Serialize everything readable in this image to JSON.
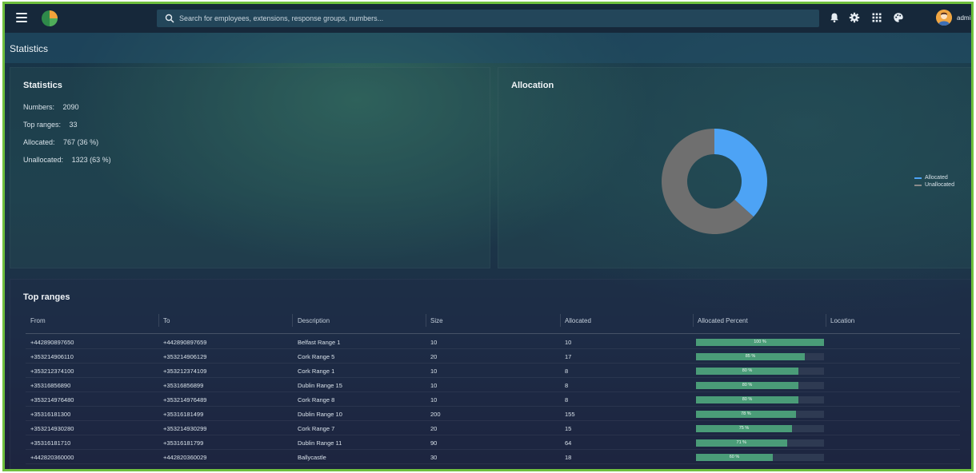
{
  "topbar": {
    "search_placeholder": "Search for employees, extensions, response groups, numbers...",
    "username": "admin",
    "icons": [
      "menu-icon",
      "logo-icon",
      "search-icon",
      "bell-icon",
      "gear-icon",
      "apps-grid-icon",
      "palette-icon",
      "avatar"
    ]
  },
  "page": {
    "title": "Statistics"
  },
  "stats": {
    "title": "Statistics",
    "rows": [
      {
        "label": "Numbers:",
        "value": "2090"
      },
      {
        "label": "Top ranges:",
        "value": "33"
      },
      {
        "label": "Allocated:",
        "value": "767 (36 %)"
      },
      {
        "label": "Unallocated:",
        "value": "1323 (63 %)"
      }
    ]
  },
  "allocation": {
    "title": "Allocation",
    "legend": [
      "Allocated",
      "Unallocated"
    ]
  },
  "chart_data": {
    "type": "pie",
    "categories": [
      "Allocated",
      "Unallocated"
    ],
    "values": [
      767,
      1323
    ],
    "colors": [
      "#4da3f5",
      "#6f6f6f"
    ],
    "legend_position": "right"
  },
  "table": {
    "title": "Top ranges",
    "headers": [
      "From",
      "To",
      "Description",
      "Size",
      "Allocated",
      "Allocated Percent",
      "Location"
    ],
    "rows": [
      {
        "from": "+442890897650",
        "to": "+442890897659",
        "description": "Belfast Range 1",
        "size": "10",
        "allocated": "10",
        "percent_label": "100 %",
        "percent": 100
      },
      {
        "from": "+353214906110",
        "to": "+353214906129",
        "description": "Cork Range 5",
        "size": "20",
        "allocated": "17",
        "percent_label": "85 %",
        "percent": 85
      },
      {
        "from": "+353212374100",
        "to": "+353212374109",
        "description": "Cork Range 1",
        "size": "10",
        "allocated": "8",
        "percent_label": "80 %",
        "percent": 80
      },
      {
        "from": "+35316856890",
        "to": "+35316856899",
        "description": "Dublin Range 15",
        "size": "10",
        "allocated": "8",
        "percent_label": "80 %",
        "percent": 80
      },
      {
        "from": "+353214976480",
        "to": "+353214976489",
        "description": "Cork Range 8",
        "size": "10",
        "allocated": "8",
        "percent_label": "80 %",
        "percent": 80
      },
      {
        "from": "+35316181300",
        "to": "+35316181499",
        "description": "Dublin Range 10",
        "size": "200",
        "allocated": "155",
        "percent_label": "78 %",
        "percent": 78
      },
      {
        "from": "+353214930280",
        "to": "+353214930299",
        "description": "Cork Range 7",
        "size": "20",
        "allocated": "15",
        "percent_label": "75 %",
        "percent": 75
      },
      {
        "from": "+35316181710",
        "to": "+35316181799",
        "description": "Dublin Range 11",
        "size": "90",
        "allocated": "64",
        "percent_label": "71 %",
        "percent": 71
      },
      {
        "from": "+442820360000",
        "to": "+442820360029",
        "description": "Ballycastle",
        "size": "30",
        "allocated": "18",
        "percent_label": "60 %",
        "percent": 60
      }
    ]
  }
}
